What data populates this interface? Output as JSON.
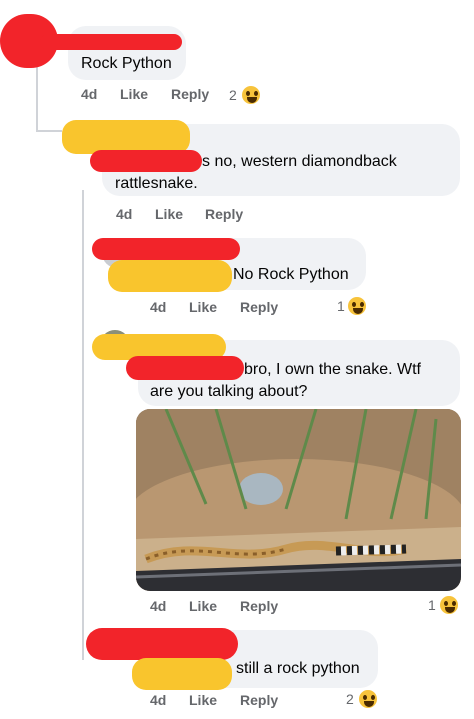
{
  "comments": [
    {
      "text": "Rock Python",
      "time": "4d",
      "like": "Like",
      "reply": "Reply",
      "reactions": "2"
    },
    {
      "text_line1": "s no, western diamondback",
      "text_line2": "rattlesnake.",
      "time": "4d",
      "like": "Like",
      "reply": "Reply"
    },
    {
      "text": "No Rock Python",
      "time": "4d",
      "like": "Like",
      "reply": "Reply",
      "reactions": "1"
    },
    {
      "text_line1": "bro, I own the snake. Wtf",
      "text_line2": "are you talking about?",
      "time": "4d",
      "like": "Like",
      "reply": "Reply",
      "reactions": "1"
    },
    {
      "text": "still a rock python",
      "time": "4d",
      "like": "Like",
      "reply": "Reply",
      "reactions": "2"
    }
  ],
  "icons": {
    "reaction": "haha-emoji-icon"
  },
  "colors": {
    "bubble": "#f0f2f5",
    "meta": "#65676b",
    "redaction_red": "#f2242a",
    "redaction_yellow": "#f9c52d"
  }
}
